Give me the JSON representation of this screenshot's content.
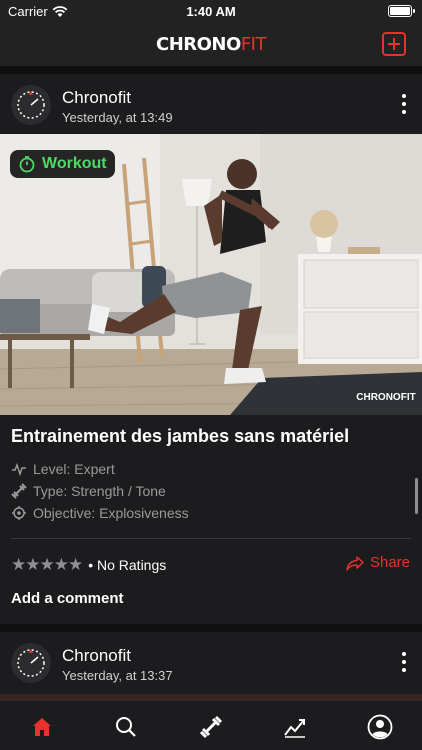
{
  "status": {
    "carrier": "Carrier",
    "time": "1:40 AM"
  },
  "header": {
    "logo_part1": "CHRONO",
    "logo_part2": "FIT"
  },
  "posts": [
    {
      "author": "Chronofit",
      "time": "Yesterday, at 13:49",
      "badge": "Workout",
      "title": "Entrainement des jambes sans matériel",
      "level": "Level: Expert",
      "type": "Type: Strength / Tone",
      "objective": "Objective: Explosiveness",
      "ratings": "No Ratings",
      "rating_value": 0,
      "share": "Share",
      "comment": "Add a comment"
    },
    {
      "author": "Chronofit",
      "time": "Yesterday, at 13:37"
    }
  ],
  "image_watermark": "CHRONOFIT",
  "tabs": [
    "home-icon",
    "search-icon",
    "dumbbell-icon",
    "progress-chart-icon",
    "profile-icon"
  ],
  "active_tab": "home-icon",
  "colors": {
    "accent": "#e8322d",
    "badge_green": "#4cd964",
    "background": "#1c1c1e"
  }
}
